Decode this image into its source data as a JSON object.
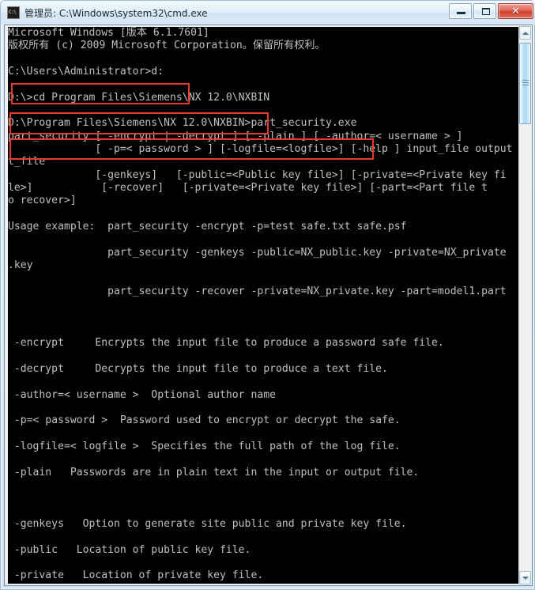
{
  "window": {
    "title": "管理员: C:\\Windows\\system32\\cmd.exe",
    "icon": "console-icon",
    "buttons": {
      "minimize": "Minimize",
      "maximize": "Maximize",
      "close": "Close"
    }
  },
  "scrollbar": {
    "up_label": "Scroll up",
    "down_label": "Scroll down",
    "thumb_label": "Scroll thumb"
  },
  "console": {
    "background": "#000000",
    "foreground": "#c0c0c0",
    "lines": [
      "Microsoft Windows [版本 6.1.7601]",
      "版权所有 (c) 2009 Microsoft Corporation。保留所有权利。",
      "",
      "C:\\Users\\Administrator>d:",
      "",
      "D:\\>cd Program Files\\Siemens\\NX 12.0\\NXBIN",
      "",
      "D:\\Program Files\\Siemens\\NX 12.0\\NXBIN>part_security.exe",
      "part_security [ -encrypt | -decrypt ] [ -plain ] [ -author=< username > ]",
      "              [ -p=< password > ] [-logfile=<logfile>] [-help ] input_file output",
      "t_file",
      "              [-genkeys]   [-public=<Public key file>] [-private=<Private key fi",
      "le>]           [-recover]   [-private=<Private key file>] [-part=<Part file t",
      "o recover>]",
      "",
      "Usage example:  part_security -encrypt -p=test safe.txt safe.psf",
      "",
      "                part_security -genkeys -public=NX_public.key -private=NX_private",
      ".key",
      "",
      "                part_security -recover -private=NX_private.key -part=model1.part",
      "",
      "",
      "",
      " -encrypt     Encrypts the input file to produce a password safe file.",
      "",
      " -decrypt     Decrypts the input file to produce a text file.",
      "",
      " -author=< username >  Optional author name",
      "",
      " -p=< password >  Password used to encrypt or decrypt the safe.",
      "",
      " -logfile=< logfile >  Specifies the full path of the log file.",
      "",
      " -plain   Passwords are in plain text in the input or output file.",
      "",
      "",
      "",
      " -genkeys   Option to generate site public and private key file.",
      "",
      " -public   Location of public key file.",
      "",
      " -private   Location of private key file."
    ]
  },
  "annotations": {
    "color": "#e8392c",
    "boxes": [
      {
        "id": "box-change-drive",
        "target": "C:\\Users\\Administrator>d:"
      },
      {
        "id": "box-cd-nxbin",
        "target": "D:\\>cd Program Files\\Siemens\\NX 12.0\\NXBIN"
      },
      {
        "id": "box-run-part-security",
        "target": "D:\\Program Files\\Siemens\\NX 12.0\\NXBIN>part_security.exe"
      }
    ]
  }
}
